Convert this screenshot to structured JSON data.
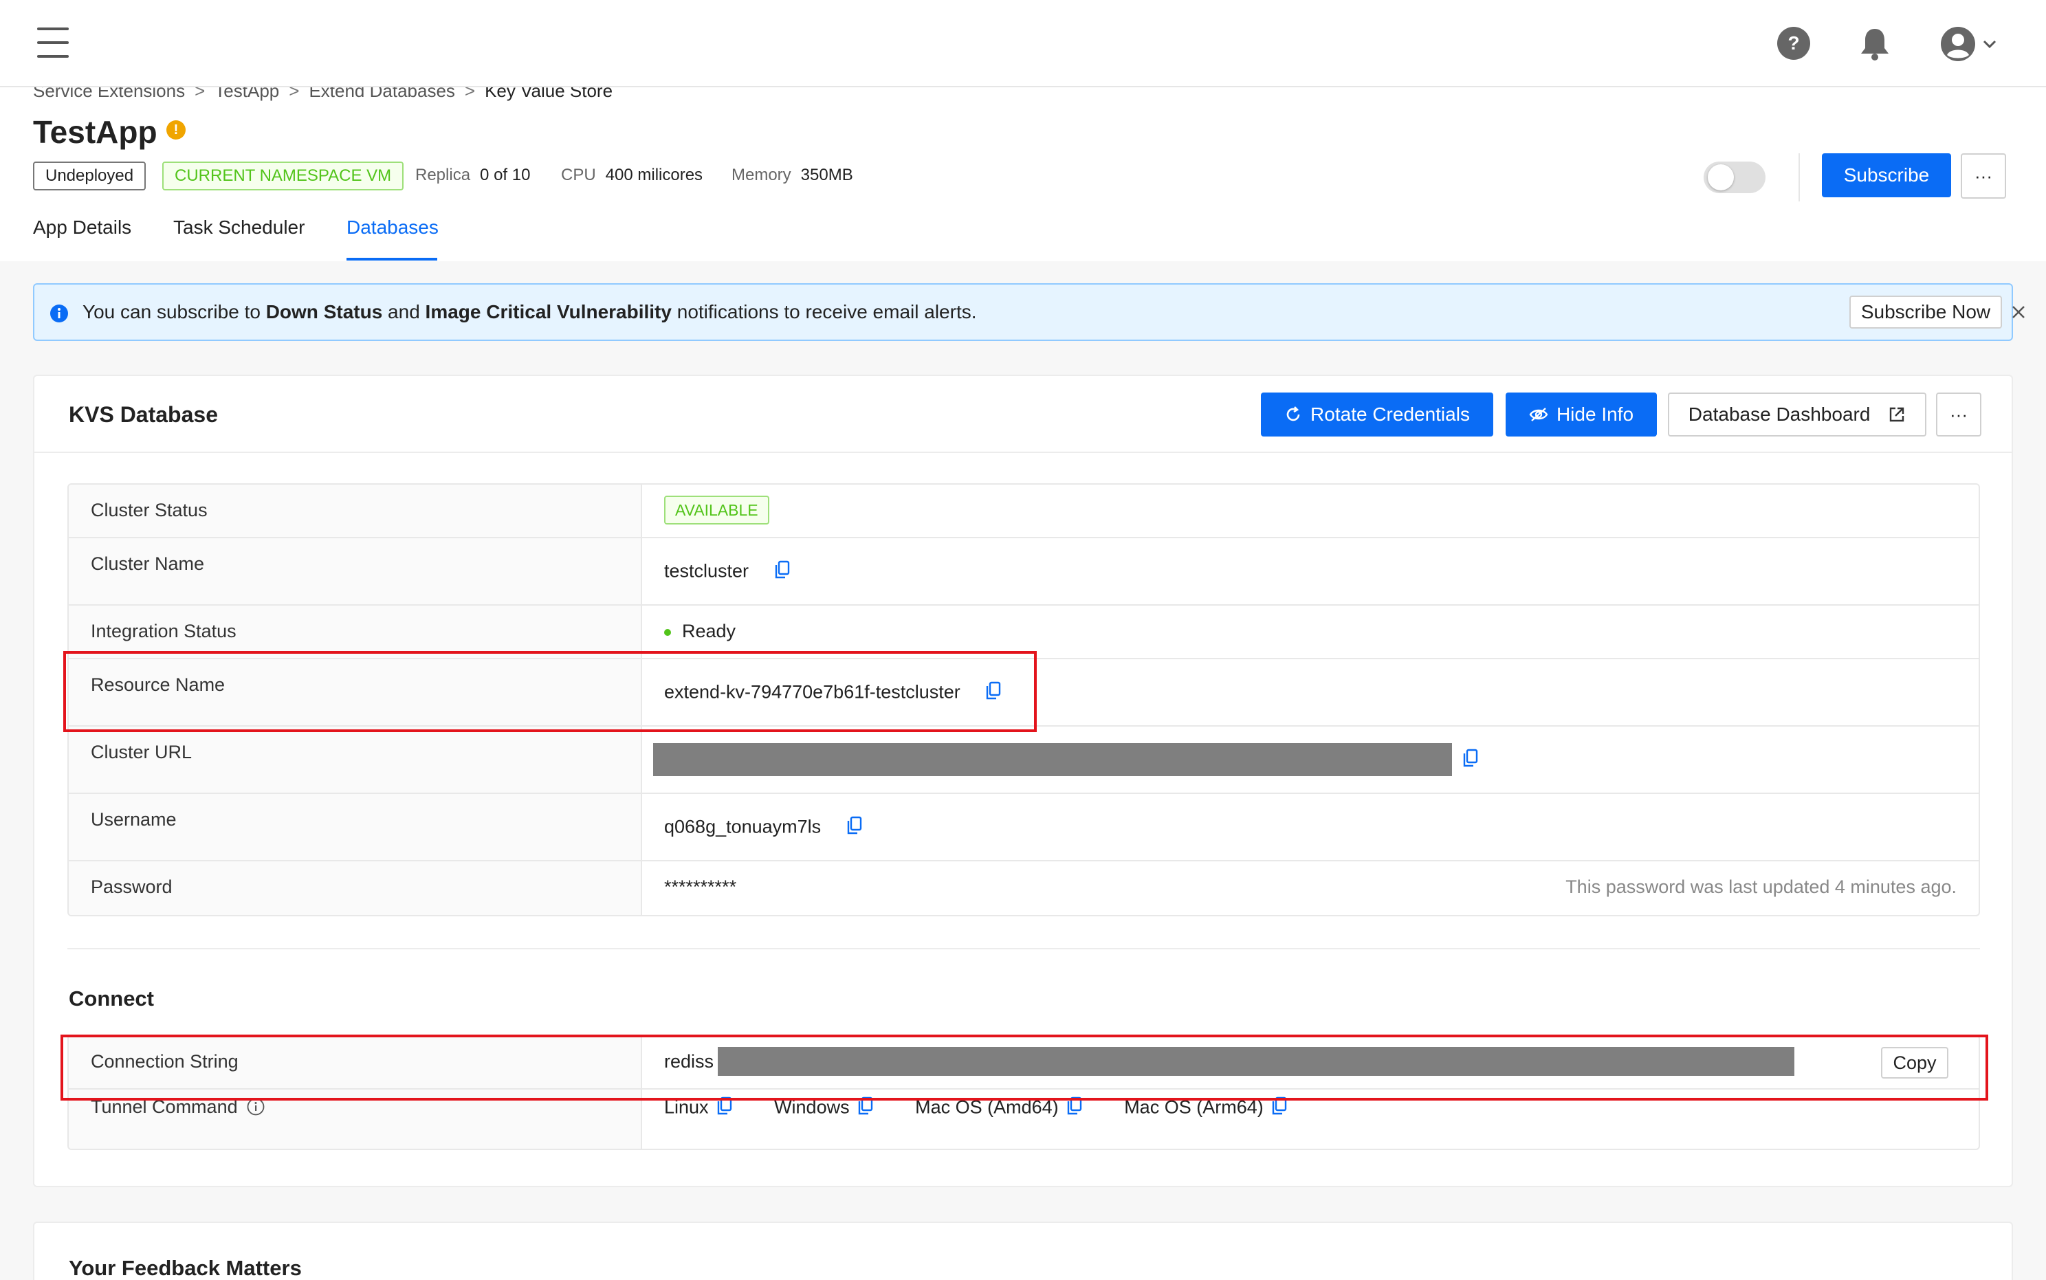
{
  "topbar": {
    "menu_icon": "hamburger-menu-icon",
    "help_icon": "help-circle-icon",
    "bell_icon": "notification-bell-icon",
    "user_icon": "user-avatar-icon",
    "chevron_icon": "chevron-down-icon"
  },
  "breadcrumb": [
    "Service Extensions",
    "TestApp",
    "Extend Databases",
    "Key Value Store"
  ],
  "breadcrumb_sep": ">",
  "app": {
    "title": "TestApp",
    "warning_mark": "!",
    "status_tag": "Undeployed",
    "namespace_tag": "CURRENT NAMESPACE VM",
    "replica_label": "Replica",
    "replica_value": "0 of 10",
    "cpu_label": "CPU",
    "cpu_value": "400 milicores",
    "memory_label": "Memory",
    "memory_value": "350MB",
    "subscribe_label": "Subscribe",
    "more_label": "···"
  },
  "tabs": [
    "App Details",
    "Task Scheduler",
    "Databases"
  ],
  "active_tab": "Databases",
  "banner": {
    "text_1": "You can subscribe to ",
    "bold_1": "Down Status",
    "text_2": " and ",
    "bold_2": "Image Critical Vulnerability",
    "text_3": " notifications to receive email alerts.",
    "button": "Subscribe Now"
  },
  "kvs": {
    "title": "KVS Database",
    "rotate_label": "Rotate Credentials",
    "hide_label": "Hide Info",
    "dashboard_label": "Database Dashboard",
    "more_label": "···",
    "rows": [
      {
        "key": "Cluster Status",
        "value": "AVAILABLE"
      },
      {
        "key": "Cluster Name",
        "value": "testcluster"
      },
      {
        "key": "Integration Status",
        "value": "Ready"
      },
      {
        "key": "Resource Name",
        "value": "extend-kv-794770e7b61f-testcluster"
      },
      {
        "key": "Cluster URL",
        "value": ""
      },
      {
        "key": "Username",
        "value": "q068g_tonuaym7ls"
      },
      {
        "key": "Password",
        "value": "**********",
        "note": "This password was last updated 4 minutes ago."
      }
    ]
  },
  "connect": {
    "title": "Connect",
    "connection_string_label": "Connection String",
    "connection_string_value": "rediss",
    "copy_label": "Copy",
    "tunnel_label": "Tunnel Command",
    "tunnel_options": [
      "Linux",
      "Windows",
      "Mac OS (Amd64)",
      "Mac OS (Arm64)"
    ]
  },
  "feedback": {
    "title": "Your Feedback Matters"
  },
  "colors": {
    "primary": "#0a6cf5",
    "success": "#52c41a",
    "warning": "#f0a500",
    "highlight": "#e3141c",
    "banner_bg": "#e6f4ff"
  }
}
